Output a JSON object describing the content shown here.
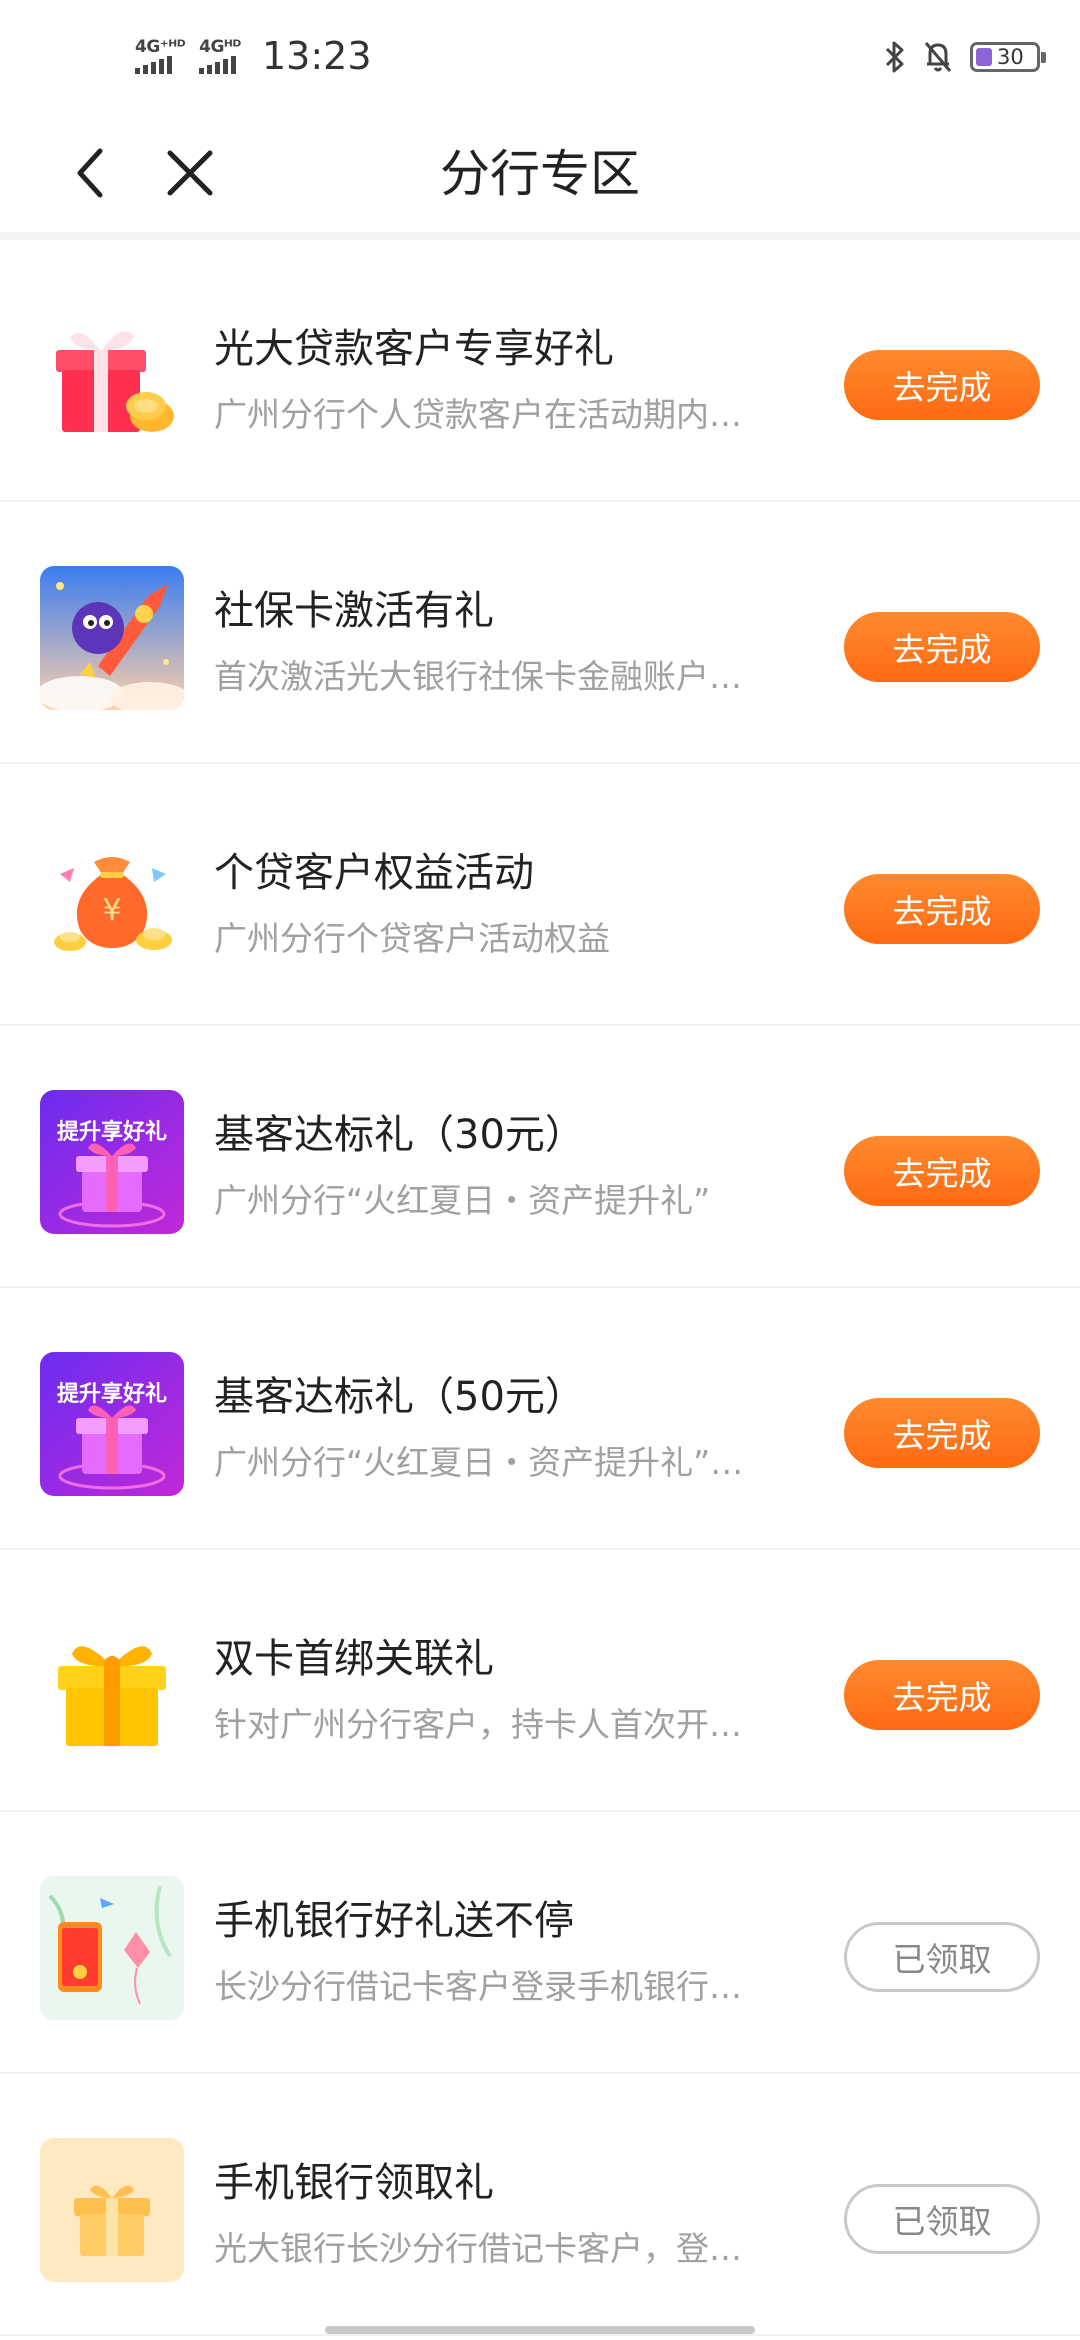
{
  "status_bar": {
    "signal1_label": "4G⁺ᴴᴰ",
    "signal2_label": "4Gᴴᴰ",
    "time": "13:23",
    "battery": "30",
    "icons": [
      "bluetooth-icon",
      "bell-off-icon",
      "battery-icon"
    ]
  },
  "nav": {
    "title": "分行专区",
    "back_icon": "back-chevron-icon",
    "close_icon": "close-icon"
  },
  "items": [
    {
      "title": "光大贷款客户专享好礼",
      "desc": "广州分行个人贷款客户在活动期内满足条件即可领取好礼",
      "button": "去完成",
      "status": "todo",
      "thumb": "red-gift-box-icon"
    },
    {
      "title": "社保卡激活有礼",
      "desc": "首次激活光大银行社保卡金融账户即可获得好礼",
      "button": "去完成",
      "status": "todo",
      "thumb": "rocket-mascot-icon"
    },
    {
      "title": "个贷客户权益活动",
      "desc": "广州分行个贷客户活动权益",
      "button": "去完成",
      "status": "todo",
      "thumb": "money-bag-icon"
    },
    {
      "title": "基客达标礼（30元）",
      "desc": "广州分行“火红夏日・资产提升礼”",
      "button": "去完成",
      "status": "todo",
      "thumb": "purple-gift-banner-icon",
      "thumb_text": "提升享好礼"
    },
    {
      "title": "基客达标礼（50元）",
      "desc": "广州分行“火红夏日・资产提升礼”活动",
      "button": "去完成",
      "status": "todo",
      "thumb": "purple-gift-banner-icon",
      "thumb_text": "提升享好礼"
    },
    {
      "title": "双卡首绑关联礼",
      "desc": "针对广州分行客户，持卡人首次开通双卡绑定",
      "button": "去完成",
      "status": "todo",
      "thumb": "yellow-gift-box-icon"
    },
    {
      "title": "手机银行好礼送不停",
      "desc": "长沙分行借记卡客户登录手机银行即可领取好礼",
      "button": "已领取",
      "status": "done",
      "thumb": "phone-red-envelope-icon"
    },
    {
      "title": "手机银行领取礼",
      "desc": "光大银行长沙分行借记卡客户，登录手机银行领取",
      "button": "已领取",
      "status": "done",
      "thumb": "pale-gift-icon"
    }
  ],
  "colors": {
    "accent_orange": "#ff6a12",
    "done_border": "#c9c9c9",
    "title_text": "#222222",
    "desc_text": "#a0a0a0"
  }
}
